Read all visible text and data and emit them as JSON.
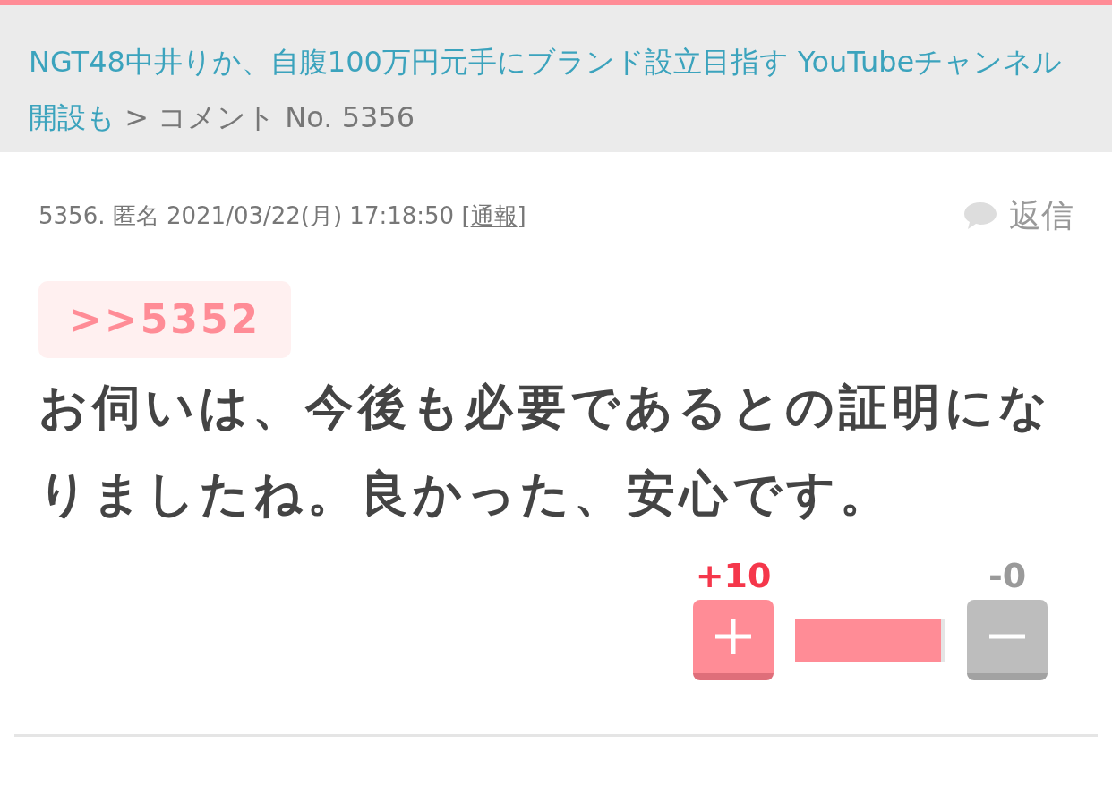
{
  "breadcrumb": {
    "link": "NGT48中井りか、自腹100万円元手にブランド設立目指す YouTubeチャンネル開設も",
    "separator": ">",
    "current": "コメント No. 5356"
  },
  "comment": {
    "meta": "5356. 匿名 2021/03/22(月) 17:18:50 [",
    "report": "通報",
    "meta_end": "]",
    "reply": "返信",
    "anchor": ">>5352",
    "body": "お伺いは、今後も必要であるとの証明になりましたね。良かった、安心です。",
    "votes": {
      "plus": "+10",
      "minus": "-0",
      "level": 0.97
    }
  }
}
